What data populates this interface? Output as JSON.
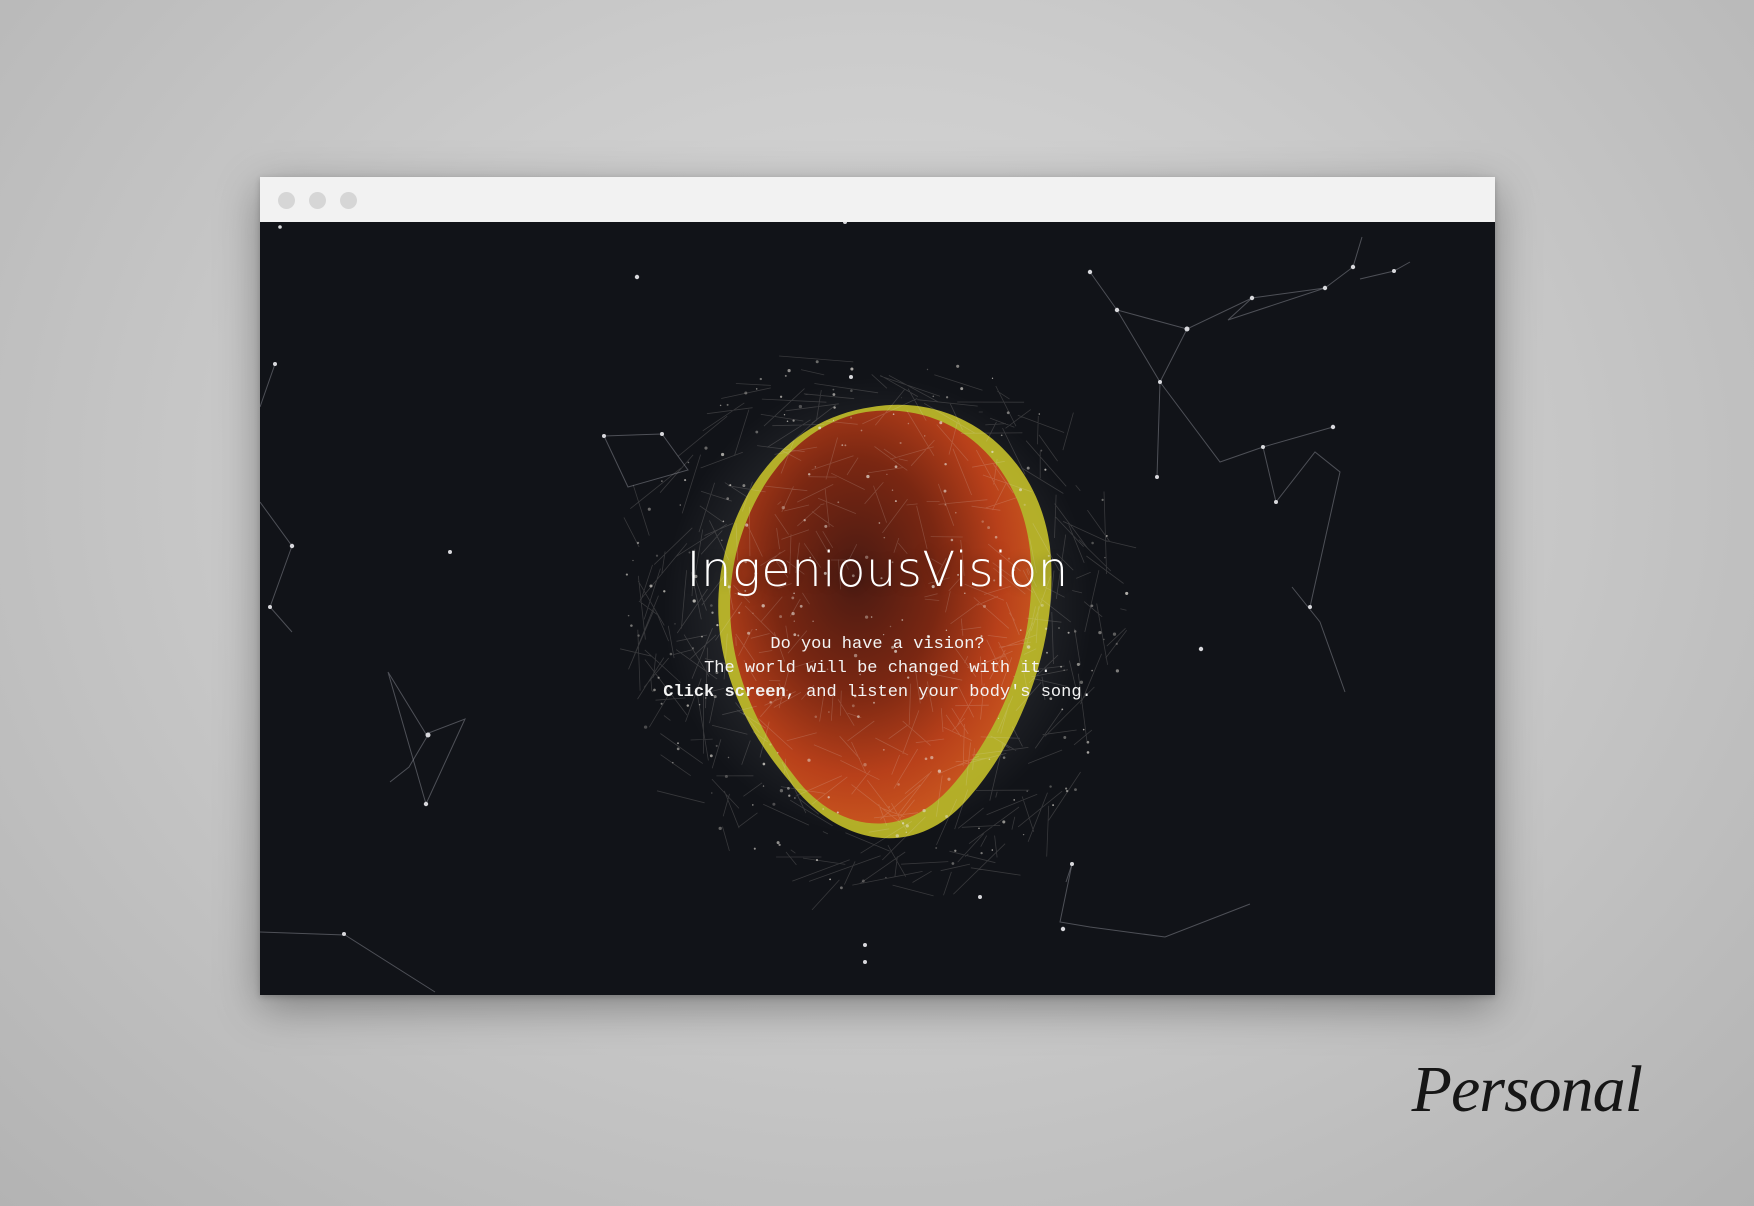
{
  "browser": {
    "window_controls": [
      "close",
      "minimize",
      "maximize"
    ]
  },
  "site": {
    "title": "IngeniousVision",
    "tagline_line1": "Do you have a vision?",
    "tagline_line2": "The world will be changed with it.",
    "tagline_line3_bold": "Click screen",
    "tagline_line3_rest": ", and listen your body's song."
  },
  "caption": "Personal",
  "colors": {
    "background": "#111318",
    "orb_core": "#8a2a12",
    "orb_edge": "#d8d22a",
    "particles": "#e8e4dc"
  }
}
